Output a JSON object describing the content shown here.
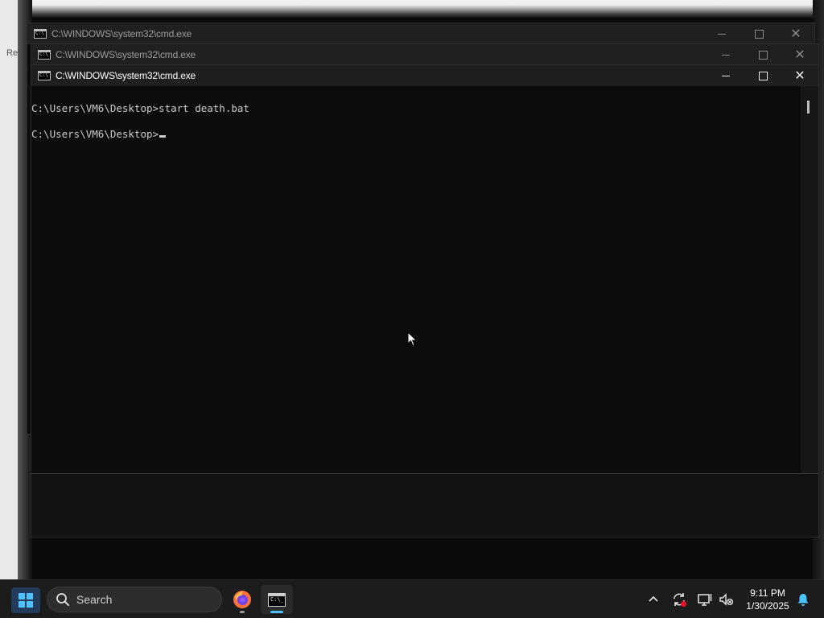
{
  "desktop": {
    "edge_text": "Re"
  },
  "windows": [
    {
      "title": "C:\\WINDOWS\\system32\\cmd.exe",
      "state": "inactive"
    },
    {
      "title": "C:\\WINDOWS\\system32\\cmd.exe",
      "state": "inactive"
    },
    {
      "title": "C:\\WINDOWS\\system32\\cmd.exe",
      "state": "active",
      "console_lines": [
        "C:\\Users\\VM6\\Desktop>start death.bat",
        "C:\\Users\\VM6\\Desktop>"
      ]
    }
  ],
  "taskbar": {
    "search_label": "Search",
    "apps": [
      "firefox-icon",
      "cmd-icon"
    ],
    "tray_icons": [
      "chevron-up-icon",
      "sync-icon",
      "network-icon",
      "volume-muted-icon",
      "notification-bell-icon"
    ],
    "clock_time": "9:11 PM",
    "clock_date": "1/30/2025",
    "accent_color": "#4cc2ff"
  }
}
